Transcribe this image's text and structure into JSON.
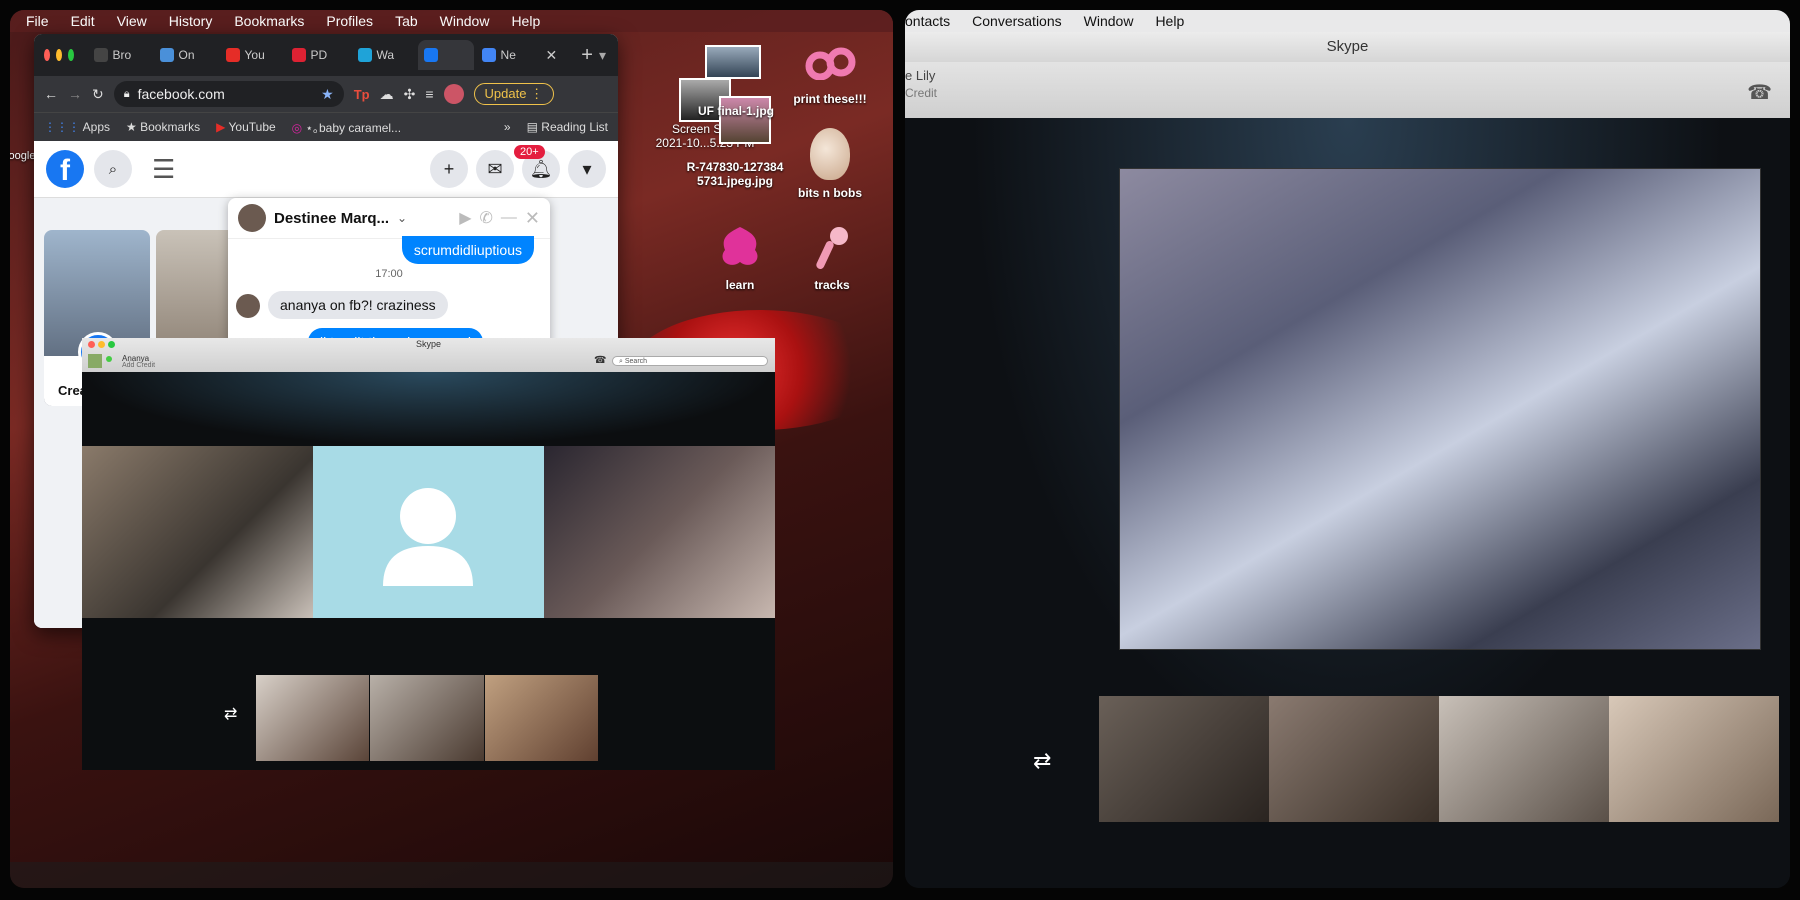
{
  "left": {
    "menubar": {
      "items": [
        "File",
        "Edit",
        "View",
        "History",
        "Bookmarks",
        "Profiles",
        "Tab",
        "Window",
        "Help"
      ]
    },
    "chrome": {
      "tabs": [
        {
          "label": "Bro",
          "color": "#444"
        },
        {
          "label": "On",
          "color": "#4a90d9"
        },
        {
          "label": "You",
          "color": "#e52d27"
        },
        {
          "label": "PD",
          "color": "#d23"
        },
        {
          "label": "Wa",
          "color": "#1fa3d8"
        },
        {
          "label": "",
          "color": "#1877f2"
        },
        {
          "label": "Ne",
          "color": "#4285f4"
        }
      ],
      "url": "facebook.com",
      "update_label": "Update",
      "bookmarks": [
        "Apps",
        "Bookmarks",
        "YouTube",
        "⋆｡baby caramel..."
      ],
      "bookmarks_more": "»",
      "reading_list": "Reading List",
      "notif_badge": "20+",
      "story_create_label": "Crea"
    },
    "chat": {
      "name": "Destinee Marq...",
      "sent_1": "scrumdidliuptious",
      "time": "17:00",
      "received_1": "ananya on fb?! craziness",
      "sent_2": "lkterallt the only reason i"
    },
    "desktop": {
      "screenshot_label": "Screen Shot\n2021-10...5.23 PM",
      "uf_label": "UF final-1.jpg",
      "jpeg_label": "R-747830-127384\n5731.jpeg.jpg",
      "print_label": "print these!!!",
      "bits_label": "bits n bobs",
      "learn_label": "learn",
      "tracks_label": "tracks",
      "google_label": "oogle"
    },
    "skype": {
      "title": "Skype",
      "user_name": "Ananya",
      "user_sub": "Add Credit",
      "search_placeholder": "Search"
    }
  },
  "right": {
    "menubar": {
      "items": [
        "ontacts",
        "Conversations",
        "Window",
        "Help"
      ]
    },
    "skype": {
      "title": "Skype",
      "user_name": "e Lily",
      "user_sub": "Credit"
    }
  },
  "colors": {
    "facebook_blue": "#1877f2",
    "messenger_bubble": "#0084ff",
    "skype_placeholder_bg": "#a8dbe6"
  }
}
